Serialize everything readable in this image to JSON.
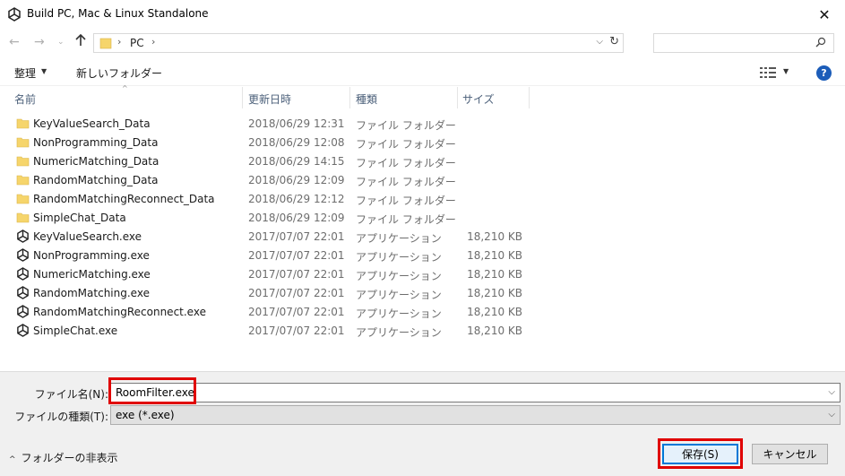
{
  "window": {
    "title": "Build PC, Mac & Linux Standalone",
    "close_glyph": "✕",
    "icon": "unity-logo-icon"
  },
  "address": {
    "back_glyph": "←",
    "forward_glyph": "→",
    "recent_glyph": "⌄",
    "up_glyph": "🡑",
    "breadcrumb_sep": "›",
    "location": "PC",
    "dropdown_glyph": "⌵",
    "refresh_glyph": "↻",
    "search_placeholder": ""
  },
  "commands": {
    "organize": "整理",
    "organize_caret": "▼",
    "new_folder": "新しいフォルダー",
    "view_caret": "▼",
    "help": "?"
  },
  "columns": {
    "name": "名前",
    "date": "更新日時",
    "type": "種類",
    "size": "サイズ",
    "sort_glyph": "^"
  },
  "files": [
    {
      "name": "KeyValueSearch_Data",
      "date": "2018/06/29 12:31",
      "type": "ファイル フォルダー",
      "size": "",
      "kind": "folder"
    },
    {
      "name": "NonProgramming_Data",
      "date": "2018/06/29 12:08",
      "type": "ファイル フォルダー",
      "size": "",
      "kind": "folder"
    },
    {
      "name": "NumericMatching_Data",
      "date": "2018/06/29 14:15",
      "type": "ファイル フォルダー",
      "size": "",
      "kind": "folder"
    },
    {
      "name": "RandomMatching_Data",
      "date": "2018/06/29 12:09",
      "type": "ファイル フォルダー",
      "size": "",
      "kind": "folder"
    },
    {
      "name": "RandomMatchingReconnect_Data",
      "date": "2018/06/29 12:12",
      "type": "ファイル フォルダー",
      "size": "",
      "kind": "folder"
    },
    {
      "name": "SimpleChat_Data",
      "date": "2018/06/29 12:09",
      "type": "ファイル フォルダー",
      "size": "",
      "kind": "folder"
    },
    {
      "name": "KeyValueSearch.exe",
      "date": "2017/07/07 22:01",
      "type": "アプリケーション",
      "size": "18,210 KB",
      "kind": "app"
    },
    {
      "name": "NonProgramming.exe",
      "date": "2017/07/07 22:01",
      "type": "アプリケーション",
      "size": "18,210 KB",
      "kind": "app"
    },
    {
      "name": "NumericMatching.exe",
      "date": "2017/07/07 22:01",
      "type": "アプリケーション",
      "size": "18,210 KB",
      "kind": "app"
    },
    {
      "name": "RandomMatching.exe",
      "date": "2017/07/07 22:01",
      "type": "アプリケーション",
      "size": "18,210 KB",
      "kind": "app"
    },
    {
      "name": "RandomMatchingReconnect.exe",
      "date": "2017/07/07 22:01",
      "type": "アプリケーション",
      "size": "18,210 KB",
      "kind": "app"
    },
    {
      "name": "SimpleChat.exe",
      "date": "2017/07/07 22:01",
      "type": "アプリケーション",
      "size": "18,210 KB",
      "kind": "app"
    }
  ],
  "form": {
    "filename_label": "ファイル名(N):",
    "filename_value": "RoomFilter.exe",
    "filetype_label": "ファイルの種類(T):",
    "filetype_value": "exe (*.exe)",
    "dropdown_glyph": "⌵"
  },
  "footer": {
    "hide_folders_caret": "^",
    "hide_folders": "フォルダーの非表示",
    "save": "保存(S)",
    "cancel": "キャンセル"
  },
  "colors": {
    "folder": "#f6d56b",
    "accent": "#0078d7",
    "highlight": "#e00000",
    "help": "#1c5db9"
  }
}
